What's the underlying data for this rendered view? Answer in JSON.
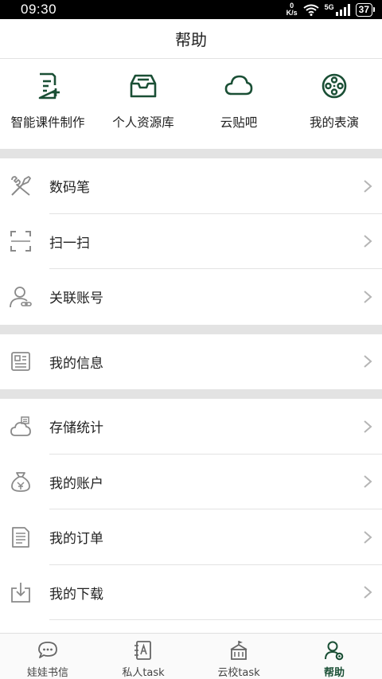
{
  "status": {
    "time": "09:30",
    "net_speed": "0",
    "net_unit": "K/s",
    "signal_label": "5G",
    "battery": "37"
  },
  "header": {
    "title": "帮助"
  },
  "quick_actions": [
    {
      "label": "智能课件制作",
      "icon": "document-add-icon"
    },
    {
      "label": "个人资源库",
      "icon": "inbox-tray-icon"
    },
    {
      "label": "云贴吧",
      "icon": "cloud-icon"
    },
    {
      "label": "我的表演",
      "icon": "film-reel-icon"
    }
  ],
  "menu_groups": [
    [
      {
        "label": "数码笔",
        "icon": "tools-icon"
      },
      {
        "label": "扫一扫",
        "icon": "scan-icon"
      },
      {
        "label": "关联账号",
        "icon": "user-link-icon"
      }
    ],
    [
      {
        "label": "我的信息",
        "icon": "id-card-icon"
      }
    ],
    [
      {
        "label": "存储统计",
        "icon": "cloud-storage-icon"
      },
      {
        "label": "我的账户",
        "icon": "money-bag-icon"
      },
      {
        "label": "我的订单",
        "icon": "order-list-icon"
      },
      {
        "label": "我的下载",
        "icon": "download-icon"
      }
    ]
  ],
  "bottom_nav": [
    {
      "label": "娃娃书信",
      "icon": "chat-bubble-icon",
      "active": false
    },
    {
      "label": "私人task",
      "icon": "contacts-book-icon",
      "active": false
    },
    {
      "label": "云校task",
      "icon": "school-building-icon",
      "active": false
    },
    {
      "label": "帮助",
      "icon": "help-user-icon",
      "active": true
    }
  ],
  "colors": {
    "accent": "#1a4f35",
    "divider_band": "#e3e3e3",
    "icon_gray": "#8a8a8a"
  }
}
